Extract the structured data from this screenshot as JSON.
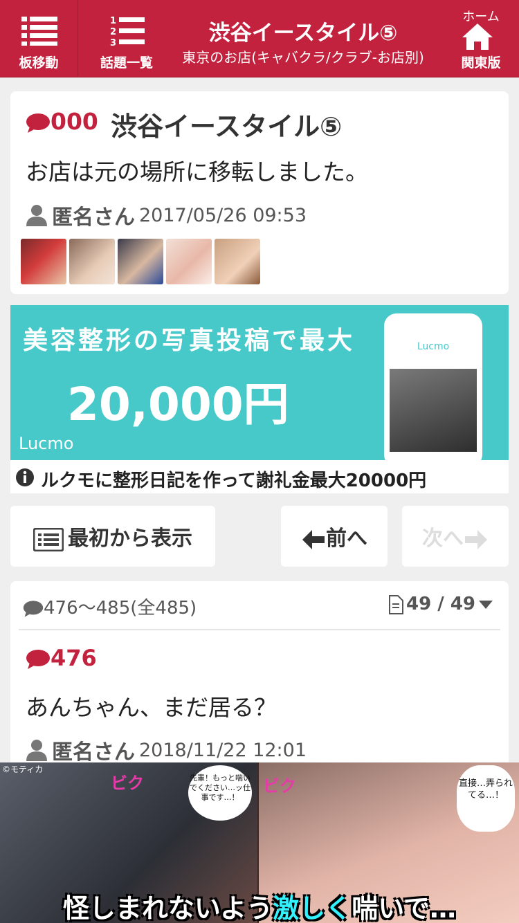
{
  "header": {
    "board_move_label": "板移動",
    "topic_list_label": "話題一覧",
    "title": "渋谷イースタイル⑤",
    "subtitle": "東京のお店(キャバクラ/クラブ-お店別)",
    "home_top_label": "ホーム",
    "home_region_label": "関東版"
  },
  "first_post": {
    "res_no": "000",
    "title": "渋谷イースタイル⑤",
    "body": "お店は元の場所に移転しました。",
    "author": "匿名さん",
    "date": "2017/05/26 09:53"
  },
  "ad": {
    "headline": "美容整形の写真投稿で最大",
    "amount": "20,000円",
    "brand": "Lucmo",
    "phone_brand": "Lucmo",
    "caption": "ルクモに整形日記を作って謝礼金最大20000円"
  },
  "nav": {
    "first_label": "最初から表示",
    "prev_label": "前へ",
    "next_label": "次へ"
  },
  "thread": {
    "range": "476～485(全485)",
    "page": "49 / 49",
    "posts": [
      {
        "res_no": "476",
        "body": "あんちゃん、まだ居る？",
        "author": "匿名さん",
        "date": "2018/11/22 12:01"
      }
    ]
  },
  "manga_ad": {
    "credit": "©モティカ",
    "bubble_left": "先輩！もっと喘いでください…ッ仕事です…！",
    "bubble_right": "直接…弄られてる…！",
    "tagline_prefix": "怪しまれないよう",
    "tagline_highlight": "激しく",
    "tagline_suffix": "喘いで…"
  },
  "colors": {
    "brand": "#c3223e",
    "ad_bg": "#47c9c9",
    "page_bg": "#efeff0"
  },
  "icons": [
    "list-icon",
    "numbered-list-icon",
    "home-icon",
    "comment-icon",
    "person-icon",
    "info-icon",
    "document-icon",
    "arrow-left-icon",
    "arrow-right-icon",
    "caret-down-icon"
  ]
}
